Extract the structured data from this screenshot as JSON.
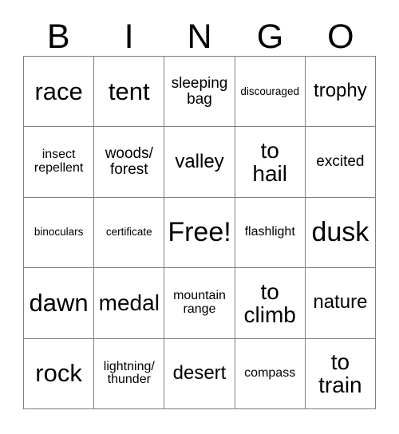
{
  "card": {
    "title": "BINGO",
    "headers": [
      "B",
      "I",
      "N",
      "G",
      "O"
    ],
    "free_space": "Free!",
    "colors": {
      "background": "#ffffff",
      "text": "#000000",
      "grid_line": "#808080"
    },
    "rows": [
      [
        {
          "text": "race",
          "size": "fs-xl"
        },
        {
          "text": "tent",
          "size": "fs-xl"
        },
        {
          "text": "sleeping\nbag",
          "size": "fs-sm"
        },
        {
          "text": "discouraged",
          "size": "fs-xxs"
        },
        {
          "text": "trophy",
          "size": "fs-md"
        }
      ],
      [
        {
          "text": "insect\nrepellent",
          "size": "fs-xs"
        },
        {
          "text": "woods/\nforest",
          "size": "fs-sm"
        },
        {
          "text": "valley",
          "size": "fs-md"
        },
        {
          "text": "to\nhail",
          "size": "fs-lg"
        },
        {
          "text": "excited",
          "size": "fs-sm"
        }
      ],
      [
        {
          "text": "binoculars",
          "size": "fs-xxs"
        },
        {
          "text": "certificate",
          "size": "fs-xxs"
        },
        {
          "text": "Free!",
          "size": "fs-xxl"
        },
        {
          "text": "flashlight",
          "size": "fs-xs"
        },
        {
          "text": "dusk",
          "size": "fs-xxl"
        }
      ],
      [
        {
          "text": "dawn",
          "size": "fs-xl"
        },
        {
          "text": "medal",
          "size": "fs-lg"
        },
        {
          "text": "mountain\nrange",
          "size": "fs-xs"
        },
        {
          "text": "to\nclimb",
          "size": "fs-lg"
        },
        {
          "text": "nature",
          "size": "fs-md"
        }
      ],
      [
        {
          "text": "rock",
          "size": "fs-xl"
        },
        {
          "text": "lightning/\nthunder",
          "size": "fs-xs"
        },
        {
          "text": "desert",
          "size": "fs-md"
        },
        {
          "text": "compass",
          "size": "fs-xs"
        },
        {
          "text": "to\ntrain",
          "size": "fs-lg"
        }
      ]
    ]
  }
}
